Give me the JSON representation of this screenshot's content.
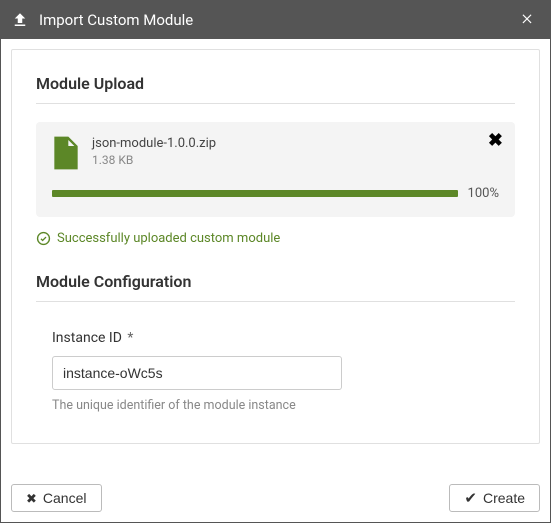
{
  "header": {
    "title": "Import Custom Module"
  },
  "upload": {
    "section_title": "Module Upload",
    "file_name": "json-module-1.0.0.zip",
    "file_size": "1.38 KB",
    "progress_percent": "100%",
    "status_message": "Successfully uploaded custom module"
  },
  "config": {
    "section_title": "Module Configuration",
    "instance_id": {
      "label": "Instance ID",
      "required_marker": "*",
      "value": "instance-oWc5s",
      "help": "The unique identifier of the module instance"
    }
  },
  "footer": {
    "cancel_label": "Cancel",
    "create_label": "Create"
  }
}
